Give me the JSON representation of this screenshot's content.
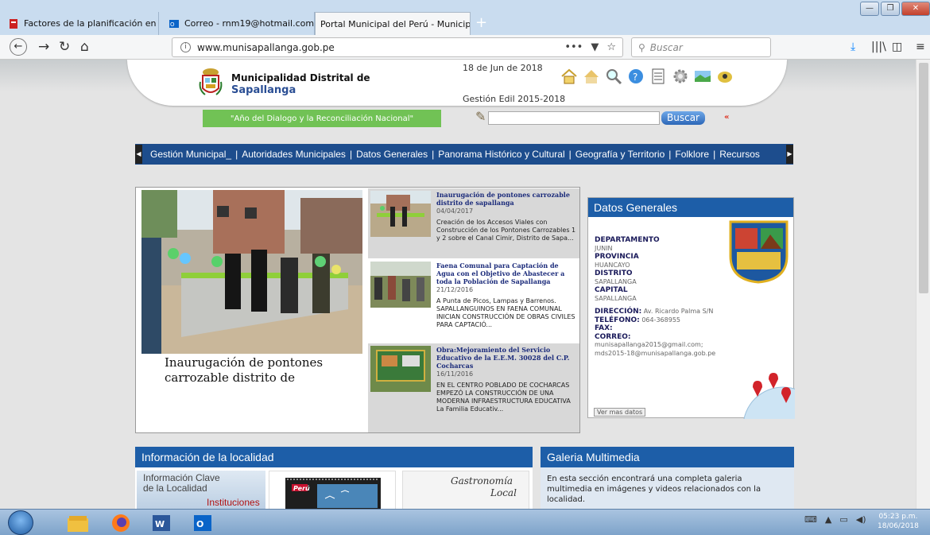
{
  "browser": {
    "tabs": [
      {
        "title": "Factores de la planificación en"
      },
      {
        "title": "Correo - rnm19@hotmail.com"
      },
      {
        "title": "Portal Municipal del Perú - Municip"
      }
    ],
    "url": "www.munisapallanga.gob.pe",
    "search_placeholder": "Buscar",
    "more_dots": "•••"
  },
  "header": {
    "org_line1": "Municipalidad Distrital de",
    "org_line2": "Sapallanga",
    "date": "18 de Jun de 2018",
    "gestion": "Gestión Edil 2015-2018",
    "slogan": "\"Año del Dialogo y la Reconciliación Nacional\"",
    "search_button": "Buscar",
    "arrows": "«"
  },
  "menu": {
    "items": [
      "Gestión Municipal_",
      "Autoridades Municipales",
      "Datos Generales",
      "Panorama Histórico y Cultural",
      "Geografía y Territorio",
      "Folklore",
      "Recursos"
    ],
    "separator": "|"
  },
  "featured": {
    "title": "Inaurugación de pontones carrozable distrito de"
  },
  "news": [
    {
      "title": "Inaurugación de pontones carrozable distrito de sapallanga",
      "date": "04/04/2017",
      "excerpt": "Creación de los Accesos Viales con Construcción de los Pontones Carrozables 1 y 2 sobre el Canal Cimir,  Distrito de Sapa..."
    },
    {
      "title": "Faena Comunal para Captación de Agua con el Objetivo de Abastecer a toda la Población de Sapallanga",
      "date": "21/12/2016",
      "excerpt": "A Punta  de Picos, Lampas y Barrenos. SAPALLANGUINOS EN FAENA COMUNAL INICIAN CONSTRUCCIÓN DE OBRAS CIVILES PARA CAPTACIÓ..."
    },
    {
      "title": "Obra:Mejoramiento del Servicio Educativo de la E.E.M. 30028 del C.P. Cocharcas",
      "date": "16/11/2016",
      "excerpt": " EN EL CENTRO POBLADO DE COCHARCAS EMPEZÓ LA CONSTRUCCIÓN DE UNA MODERNA INFRAESTRUCTURA EDUCATIVA La Familia Educativ..."
    }
  ],
  "datos_generales": {
    "heading": "Datos Generales",
    "departamento_label": "DEPARTAMENTO",
    "departamento": "JUNIN",
    "provincia_label": "PROVINCIA",
    "provincia": "HUANCAYO",
    "distrito_label": "DISTRITO",
    "distrito": "SAPALLANGA",
    "capital_label": "CAPITAL",
    "capital": "SAPALLANGA",
    "direccion_label": "DIRECCIÓN:",
    "direccion": "Av. Ricardo Palma S/N",
    "telefono_label": "TELÉFONO:",
    "telefono": "064-368955",
    "fax_label": "FAX:",
    "correo_label": "CORREO:",
    "correo1": "munisapallanga2015@gmail.com;",
    "correo2": "mds2015-18@munisapallanga.gob.pe",
    "more": "Ver mas datos"
  },
  "informacion": {
    "heading": "Información de la localidad",
    "clave_line1": "Información Clave",
    "clave_line2": "de la Localidad",
    "instituciones": "Instituciones",
    "calendar_label": "Perú",
    "gastro_line1": "Gastronomía",
    "gastro_line2": "Local"
  },
  "galeria": {
    "heading": "Galeria Multimedia",
    "text": "En esta sección encontrará una completa galeria multimedia en imágenes y videos relacionados con la localidad."
  },
  "taskbar": {
    "time": "05:23 p.m.",
    "date": "18/06/2018"
  },
  "colors": {
    "brand_blue": "#1d5ea8",
    "menu_blue": "#1d4d8d",
    "slogan_green": "#71c255"
  }
}
